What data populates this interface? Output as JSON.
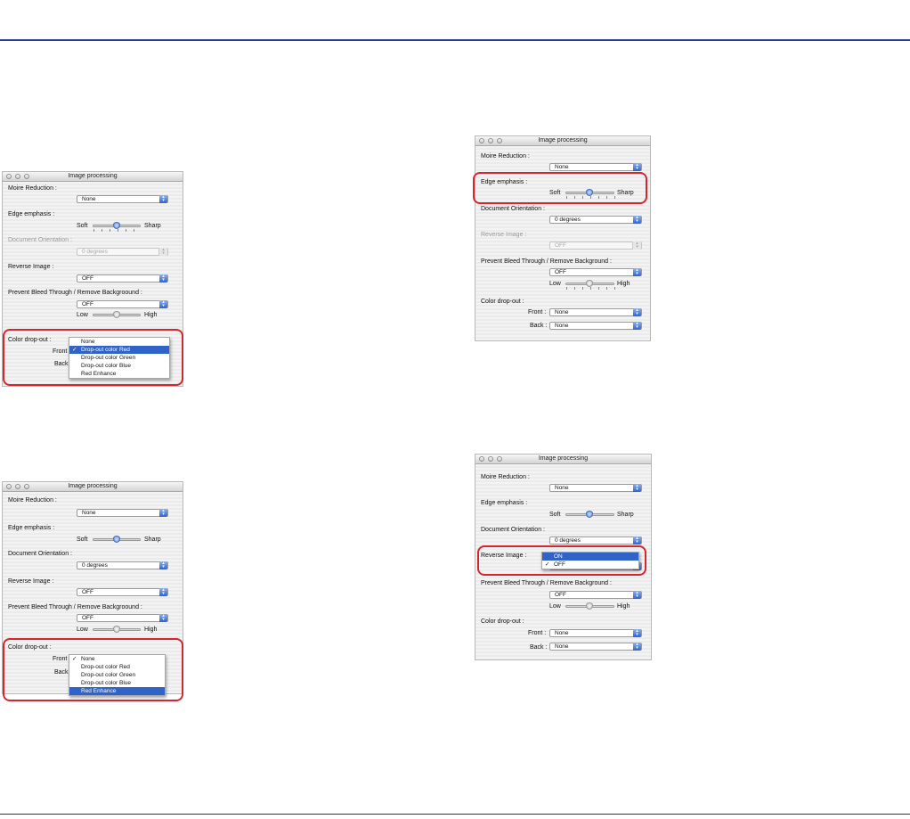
{
  "window_title": "Image processing",
  "labels": {
    "moire": "Moire Reduction :",
    "edge": "Edge emphasis :",
    "soft": "Soft",
    "sharp": "Sharp",
    "orientation": "Document Orientation :",
    "reverse": "Reverse Image :",
    "bleed": "Prevent Bleed Through / Remove Background :",
    "bleed_typo": "Prevent Bleed Through / Remove Backgroound :",
    "low": "Low",
    "high": "High",
    "color_dropout": "Color drop-out :",
    "front": "Front :",
    "back": "Back :",
    "front_short": "Front",
    "back_short": "Back"
  },
  "values": {
    "none": "None",
    "off": "OFF",
    "on": "ON",
    "degrees": "0 degrees"
  },
  "dropout_menu": [
    "None",
    "Drop-out color Red",
    "Drop-out color Green",
    "Drop-out color Blue",
    "Red Enhance"
  ],
  "check_mark": "✓",
  "edge_emphasis_level": 0.5,
  "bleed_level": 0.5,
  "colors": {
    "highlight": "#d3262e",
    "selection": "#2f63c7",
    "top_rule": "#2d3f9a"
  }
}
